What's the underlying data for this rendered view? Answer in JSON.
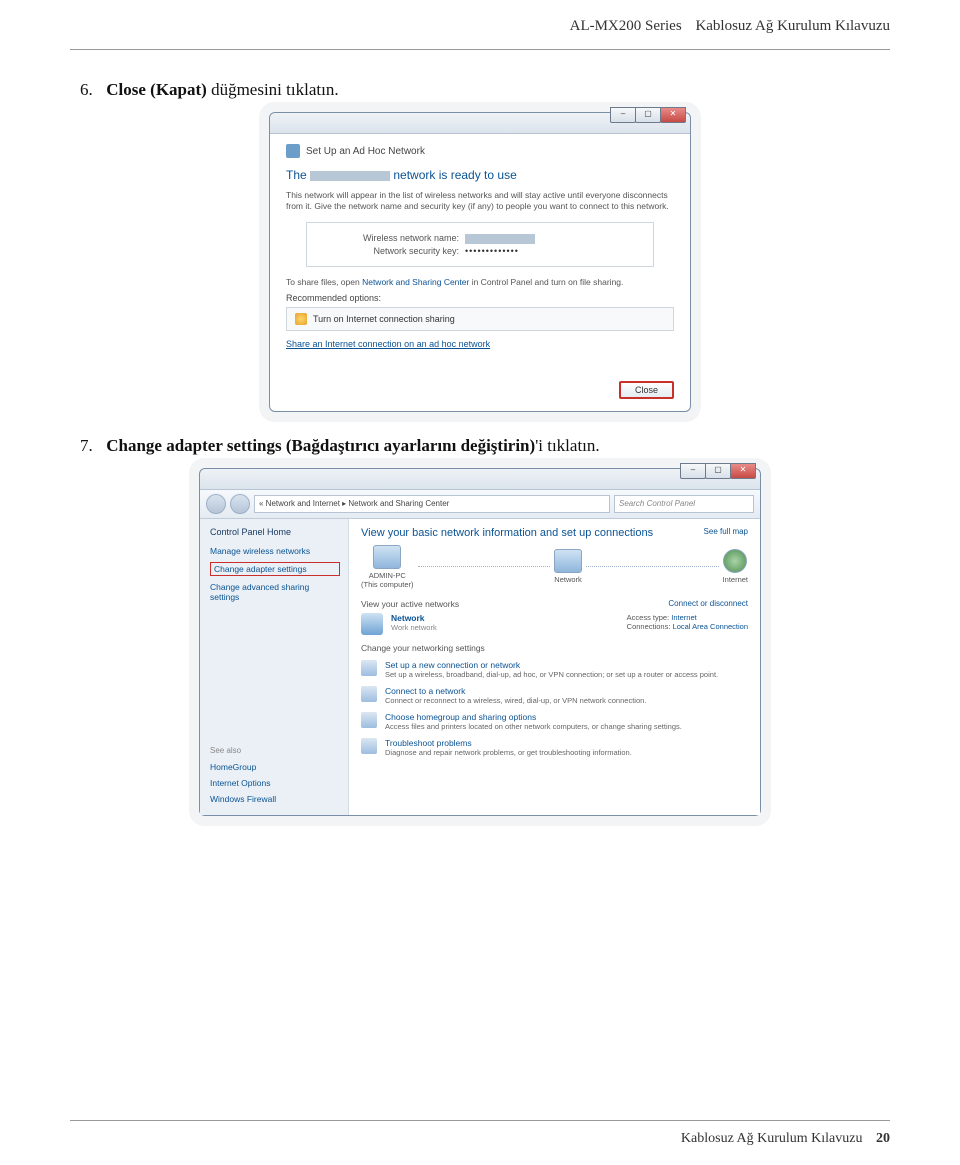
{
  "header": {
    "series": "AL-MX200 Series",
    "title": "Kablosuz Ağ Kurulum Kılavuzu"
  },
  "step6": {
    "num": "6.",
    "bold": "Close (Kapat)",
    "rest": " düğmesini tıklatın."
  },
  "wiz": {
    "win_title": "Set Up an Ad Hoc Network",
    "heading_prefix": "The ",
    "heading_suffix": " network is ready to use",
    "para": "This network will appear in the list of wireless networks and will stay active until everyone disconnects from it. Give the network name and security key (if any) to people you want to connect to this network.",
    "row1_label": "Wireless network name:",
    "row2_label": "Network security key:",
    "row2_val": "•••••••••••••",
    "share_prefix": "To share files, open ",
    "share_link": "Network and Sharing Center",
    "share_suffix": " in Control Panel and turn on file sharing.",
    "rec_title": "Recommended options:",
    "rec_opt": "Turn on Internet connection sharing",
    "rec_link": "Share an Internet connection on an ad hoc network",
    "close_btn": "Close"
  },
  "step7": {
    "num": "7.",
    "bold": "Change adapter settings (Bağdaştırıcı ayarlarını değiştirin)",
    "rest": "'i tıklatın."
  },
  "cp": {
    "crumb": "« Network and Internet  ▸  Network and Sharing Center",
    "search_placeholder": "Search Control Panel",
    "side_head": "Control Panel Home",
    "side_links": [
      "Manage wireless networks",
      "Change adapter settings",
      "Change advanced sharing settings"
    ],
    "seealso_head": "See also",
    "seealso": [
      "HomeGroup",
      "Internet Options",
      "Windows Firewall"
    ],
    "main_title": "View your basic network information and set up connections",
    "fullmap": "See full map",
    "nodes": {
      "pc": "ADMIN-PC",
      "pc_sub": "(This computer)",
      "net": "Network",
      "inet": "Internet"
    },
    "active_head": "View your active networks",
    "connect_link": "Connect or disconnect",
    "active": {
      "name": "Network",
      "sub": "Work network",
      "access_lbl": "Access type:",
      "access_val": "Internet",
      "conn_lbl": "Connections:",
      "conn_val": "Local Area Connection"
    },
    "tasks_head": "Change your networking settings",
    "tasks": [
      {
        "t": "Set up a new connection or network",
        "d": "Set up a wireless, broadband, dial-up, ad hoc, or VPN connection; or set up a router or access point."
      },
      {
        "t": "Connect to a network",
        "d": "Connect or reconnect to a wireless, wired, dial-up, or VPN network connection."
      },
      {
        "t": "Choose homegroup and sharing options",
        "d": "Access files and printers located on other network computers, or change sharing settings."
      },
      {
        "t": "Troubleshoot problems",
        "d": "Diagnose and repair network problems, or get troubleshooting information."
      }
    ]
  },
  "footer": {
    "title": "Kablosuz Ağ Kurulum Kılavuzu",
    "page": "20"
  }
}
